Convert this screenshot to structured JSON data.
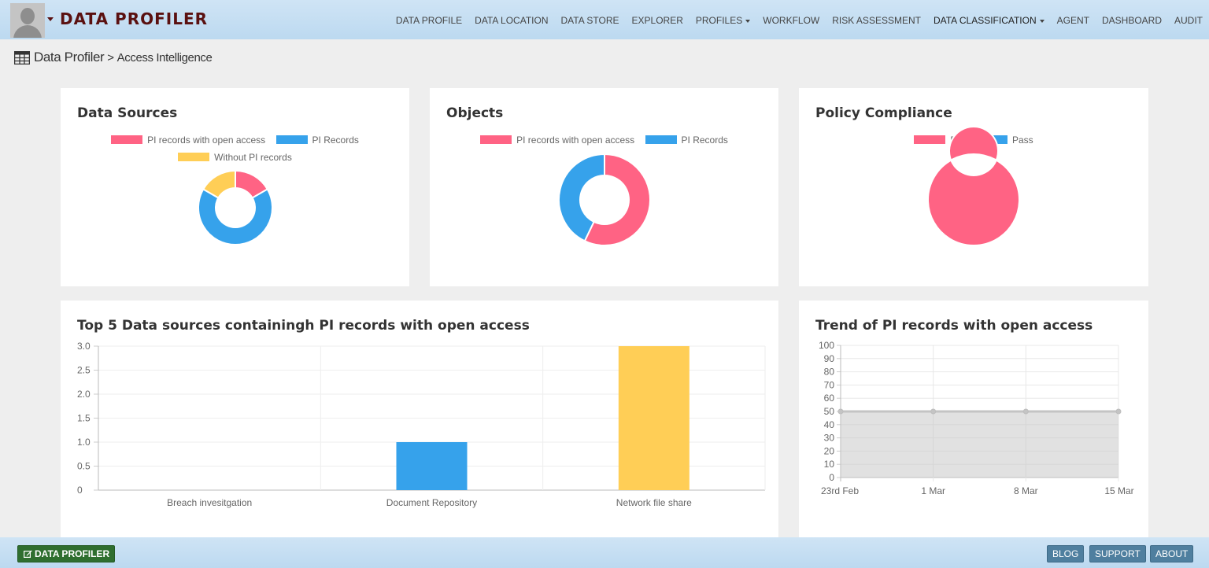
{
  "header": {
    "brand": "DATA PROFILER",
    "nav": [
      {
        "label": "DATA PROFILE",
        "caret": false
      },
      {
        "label": "DATA LOCATION",
        "caret": false
      },
      {
        "label": "DATA STORE",
        "caret": false
      },
      {
        "label": "EXPLORER",
        "caret": false
      },
      {
        "label": "PROFILES",
        "caret": true
      },
      {
        "label": "WORKFLOW",
        "caret": false
      },
      {
        "label": "RISK ASSESSMENT",
        "caret": false
      },
      {
        "label": "DATA CLASSIFICATION",
        "caret": true
      },
      {
        "label": "AGENT",
        "caret": false
      },
      {
        "label": "DASHBOARD",
        "caret": false
      },
      {
        "label": "AUDIT",
        "caret": false
      }
    ]
  },
  "breadcrumb": {
    "root": "Data Profiler",
    "separator": ">",
    "current": "Access Intelligence"
  },
  "colors": {
    "red": "#ff6384",
    "blue": "#36a2eb",
    "yellow": "#ffce56"
  },
  "cards": {
    "data_sources": {
      "title": "Data Sources"
    },
    "objects": {
      "title": "Objects"
    },
    "policy": {
      "title": "Policy Compliance"
    },
    "top5": {
      "title": "Top 5 Data sources containingh PI records with open access"
    },
    "trend": {
      "title": "Trend of PI records with open access"
    }
  },
  "chart_data": [
    {
      "type": "pie",
      "title": "Data Sources",
      "labels": [
        "PI records with open access",
        "PI Records",
        "Without PI records"
      ],
      "values": [
        1,
        4,
        1
      ],
      "colors": [
        "#ff6384",
        "#36a2eb",
        "#ffce56"
      ],
      "legend": "top"
    },
    {
      "type": "pie",
      "title": "Objects",
      "labels": [
        "PI records with open access",
        "PI Records"
      ],
      "values": [
        4,
        3
      ],
      "colors": [
        "#ff6384",
        "#36a2eb"
      ],
      "legend": "top"
    },
    {
      "type": "pie",
      "title": "Policy Compliance",
      "labels": [
        "Fail",
        "Pass"
      ],
      "values": [
        1,
        0
      ],
      "colors": [
        "#ff6384",
        "#36a2eb"
      ],
      "legend": "top"
    },
    {
      "type": "bar",
      "title": "Top 5 Data sources containingh PI records with open access",
      "categories": [
        "Breach invesitgation",
        "Document Repository",
        "Network file share"
      ],
      "values": [
        0,
        1,
        3
      ],
      "colors": [
        "#ff6384",
        "#36a2eb",
        "#ffce56"
      ],
      "ylim": [
        0,
        3
      ],
      "yticks": [
        "3.0",
        "2.5",
        "2.0",
        "1.5",
        "1.0",
        "0.5",
        "0"
      ],
      "grid": true
    },
    {
      "type": "area",
      "title": "Trend of PI records with open access",
      "x": [
        "23rd Feb",
        "1 Mar",
        "8 Mar",
        "15 Mar"
      ],
      "values": [
        50,
        50,
        50,
        50
      ],
      "ylim": [
        0,
        100
      ],
      "yticks": [
        "100",
        "90",
        "80",
        "70",
        "60",
        "50",
        "40",
        "30",
        "20",
        "10",
        "0"
      ],
      "grid": true
    }
  ],
  "footer": {
    "brand": "DATA PROFILER",
    "buttons": [
      "BLOG",
      "SUPPORT",
      "ABOUT"
    ]
  }
}
